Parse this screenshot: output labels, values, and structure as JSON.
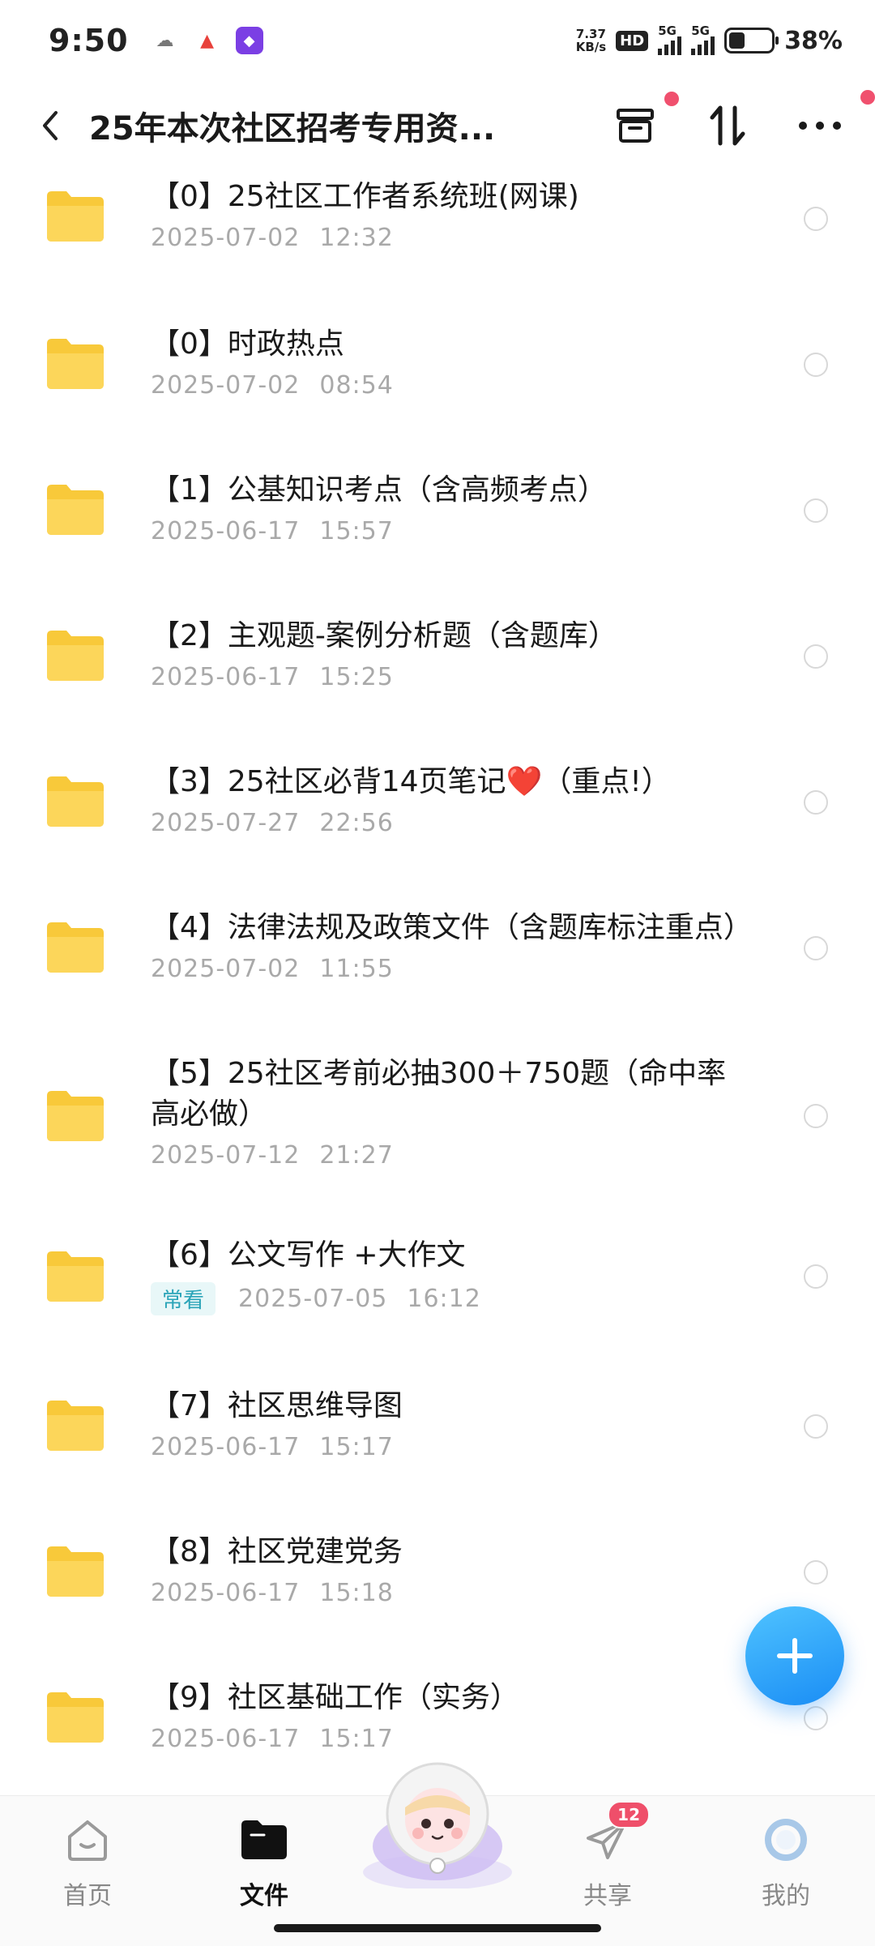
{
  "status_bar": {
    "time": "9:50",
    "net_speed_value": "7.37",
    "net_speed_unit": "KB/s",
    "hd_label": "HD",
    "signal1_label": "5G",
    "signal2_label": "5G",
    "battery_level": 0.38,
    "battery_pct": "38%"
  },
  "header": {
    "title": "25年本次社区招考专用资..."
  },
  "files": [
    {
      "name": "【0】25社区工作者系统班(网课)",
      "date": "2025-07-02",
      "time": "12:32",
      "tag": ""
    },
    {
      "name": "【0】时政热点",
      "date": "2025-07-02",
      "time": "08:54",
      "tag": ""
    },
    {
      "name": "【1】公基知识考点（含高频考点）",
      "date": "2025-06-17",
      "time": "15:57",
      "tag": ""
    },
    {
      "name": "【2】主观题-案例分析题（含题库）",
      "date": "2025-06-17",
      "time": "15:25",
      "tag": ""
    },
    {
      "name": "【3】25社区必背14页笔记❤️（重点!）",
      "date": "2025-07-27",
      "time": "22:56",
      "tag": ""
    },
    {
      "name": "【4】法律法规及政策文件（含题库标注重点）",
      "date": "2025-07-02",
      "time": "11:55",
      "tag": ""
    },
    {
      "name": "【5】25社区考前必抽300＋750题（命中率高必做）",
      "date": "2025-07-12",
      "time": "21:27",
      "tag": ""
    },
    {
      "name": "【6】公文写作 +大作文",
      "date": "2025-07-05",
      "time": "16:12",
      "tag": "常看"
    },
    {
      "name": "【7】社区思维导图",
      "date": "2025-06-17",
      "time": "15:17",
      "tag": ""
    },
    {
      "name": "【8】社区党建党务",
      "date": "2025-06-17",
      "time": "15:18",
      "tag": ""
    },
    {
      "name": "【9】社区基础工作（实务）",
      "date": "2025-06-17",
      "time": "15:17",
      "tag": ""
    }
  ],
  "tabs": {
    "home": "首页",
    "files": "文件",
    "share": "共享",
    "share_badge": "12",
    "me": "我的"
  },
  "colors": {
    "folder": "#f8c93a",
    "accent": "#1a8df5",
    "tag_text": "#2aa4b8",
    "badge": "#ef4f6a"
  }
}
